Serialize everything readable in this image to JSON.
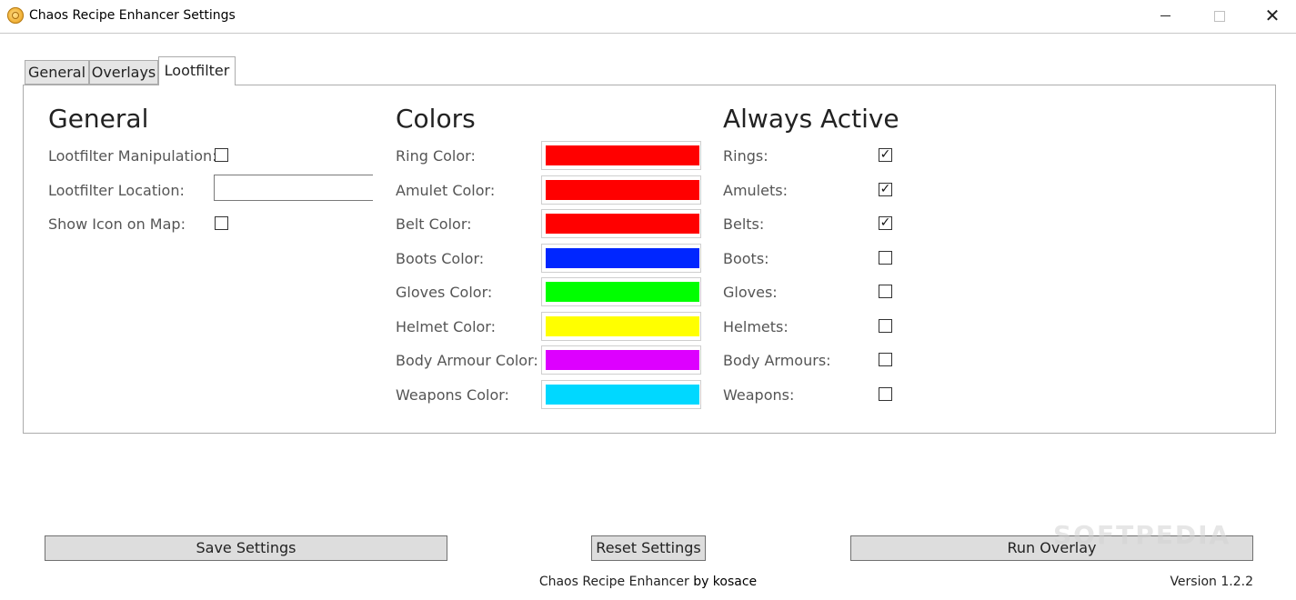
{
  "window": {
    "title": "Chaos Recipe Enhancer Settings",
    "close_glyph": "✕"
  },
  "tabs": [
    {
      "label": "General"
    },
    {
      "label": "Overlays"
    },
    {
      "label": "Lootfilter",
      "selected": true
    }
  ],
  "general": {
    "title": "General",
    "manipulation_label": "Lootfilter Manipulation:",
    "manipulation_checked": false,
    "location_label": "Lootfilter Location:",
    "location_value": "",
    "show_icon_label": "Show Icon on Map:",
    "show_icon_checked": false
  },
  "colors": {
    "title": "Colors",
    "items": [
      {
        "label": "Ring Color:",
        "color": "#ff0000"
      },
      {
        "label": "Amulet Color:",
        "color": "#ff0000"
      },
      {
        "label": "Belt Color:",
        "color": "#ff0000"
      },
      {
        "label": "Boots Color:",
        "color": "#0026ff"
      },
      {
        "label": "Gloves Color:",
        "color": "#00ff00"
      },
      {
        "label": "Helmet Color:",
        "color": "#ffff00"
      },
      {
        "label": "Body Armour Color:",
        "color": "#dd00ff"
      },
      {
        "label": "Weapons Color:",
        "color": "#00d8ff"
      }
    ]
  },
  "always_active": {
    "title": "Always Active",
    "items": [
      {
        "label": "Rings:",
        "checked": true
      },
      {
        "label": "Amulets:",
        "checked": true
      },
      {
        "label": "Belts:",
        "checked": true
      },
      {
        "label": "Boots:",
        "checked": false
      },
      {
        "label": "Gloves:",
        "checked": false
      },
      {
        "label": "Helmets:",
        "checked": false
      },
      {
        "label": "Body Armours:",
        "checked": false
      },
      {
        "label": "Weapons:",
        "checked": false
      }
    ]
  },
  "buttons": {
    "save": "Save Settings",
    "reset": "Reset Settings",
    "run": "Run Overlay"
  },
  "footer": {
    "app": "Chaos Recipe Enhancer ",
    "by": "by kosace",
    "version": "Version 1.2.2"
  },
  "watermark": "SOFTPEDIA"
}
